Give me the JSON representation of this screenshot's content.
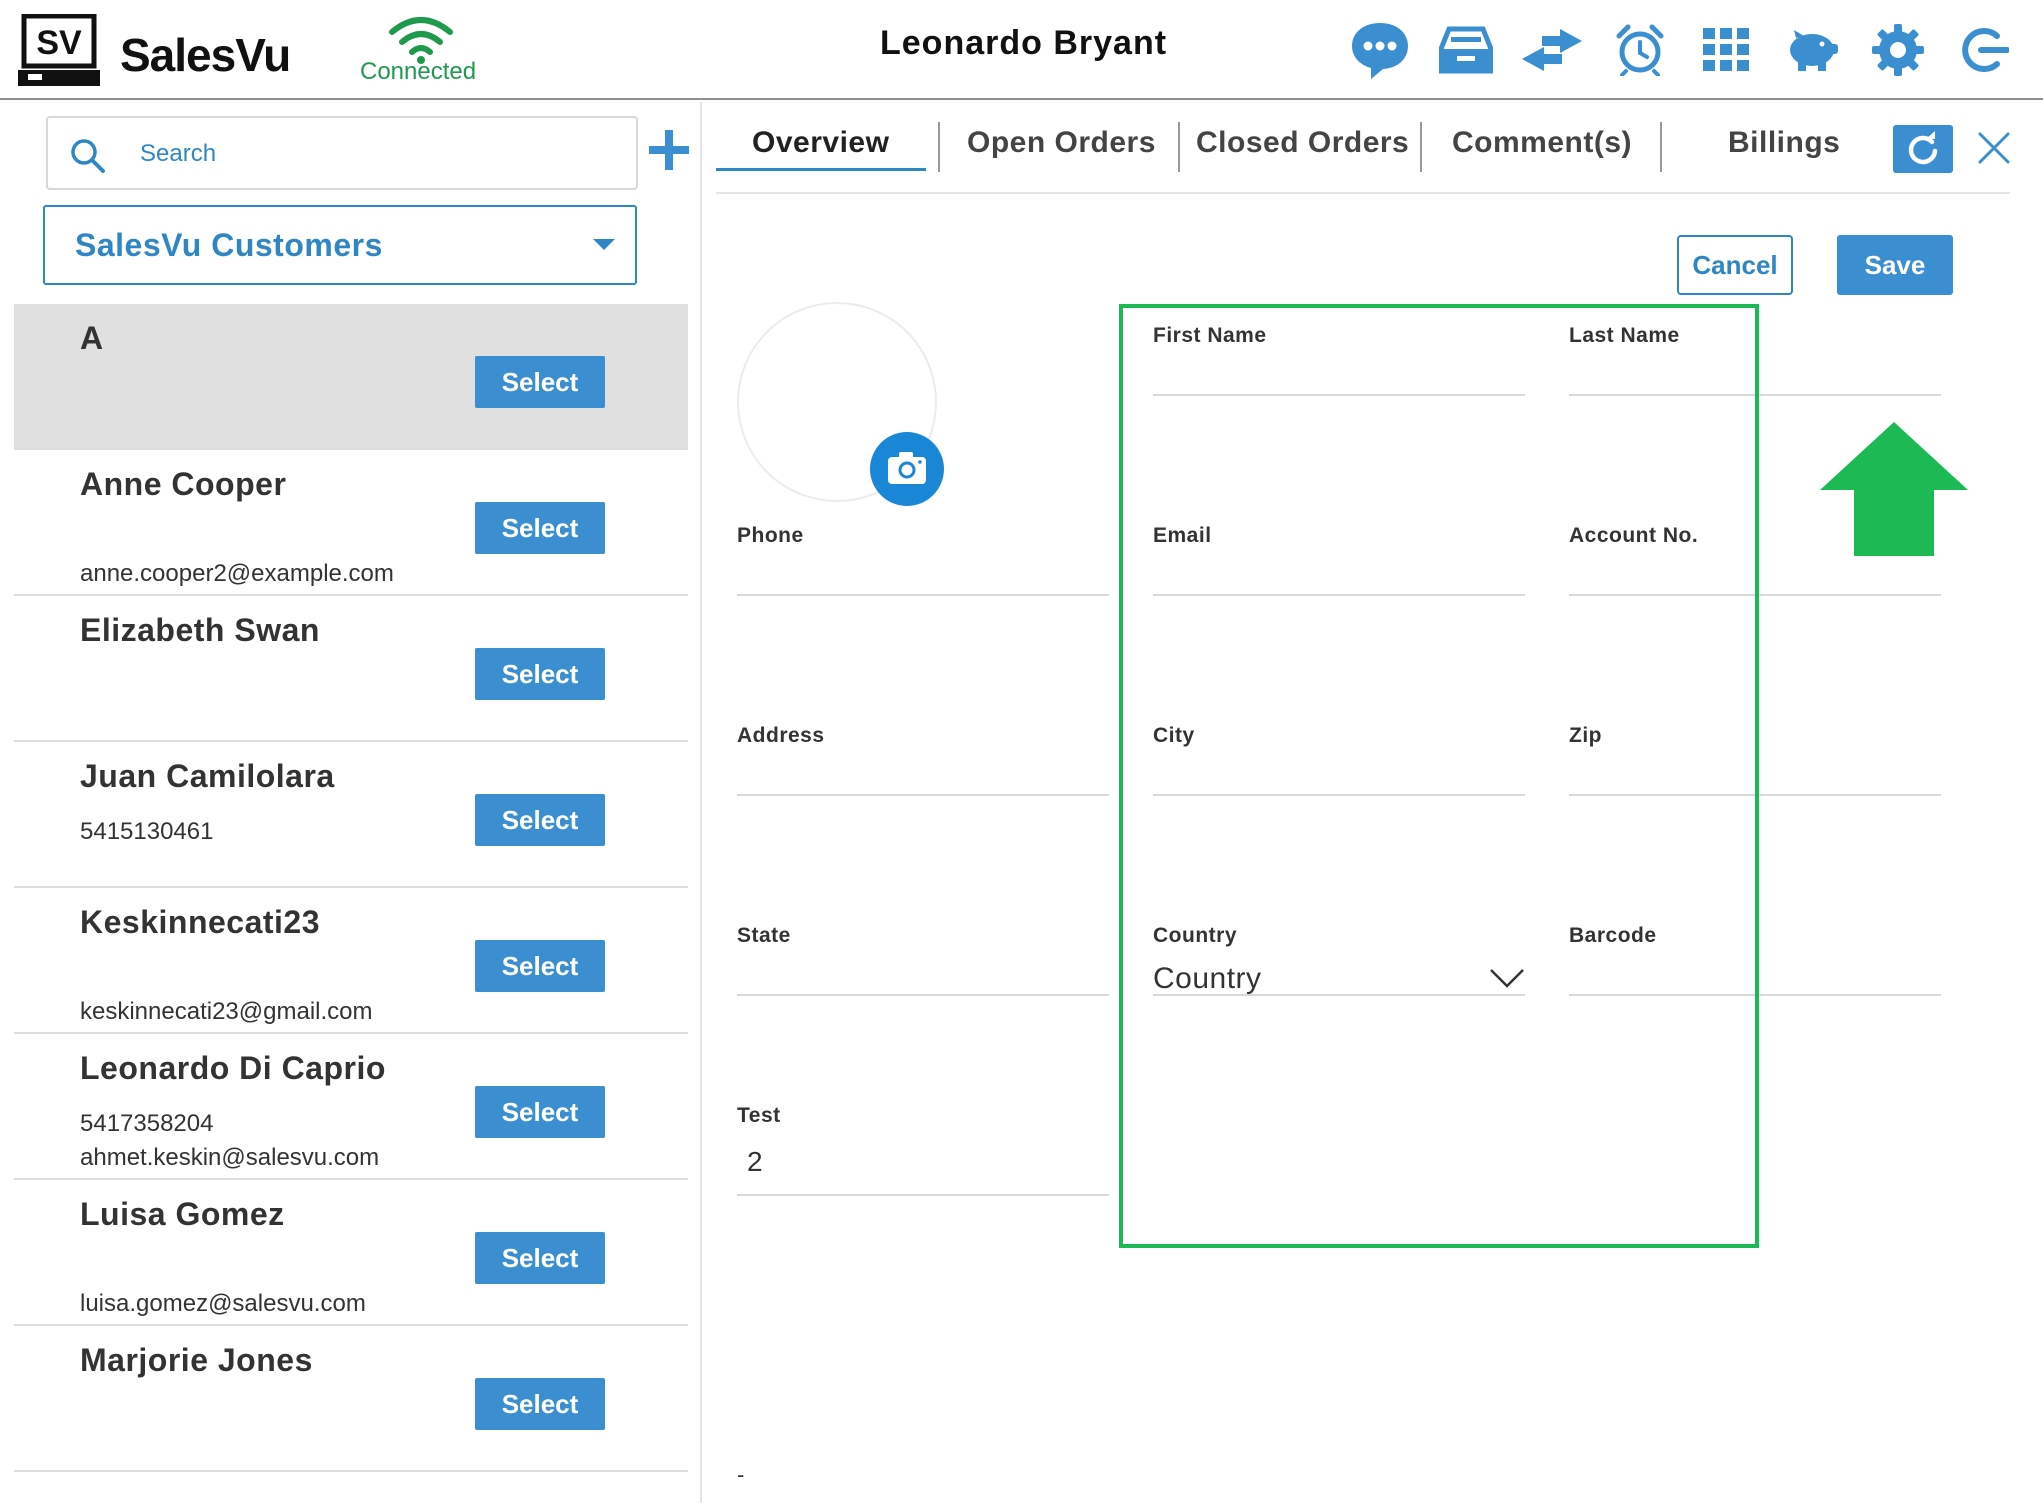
{
  "header": {
    "brand": "SalesVu",
    "logo_text": "SV",
    "connection_status": "Connected",
    "user_name": "Leonardo Bryant",
    "icons": [
      "chat-icon",
      "drawer-icon",
      "transfer-icon",
      "alarm-clock-icon",
      "grid-icon",
      "piggy-bank-icon",
      "gear-icon",
      "logout-icon"
    ]
  },
  "left_panel": {
    "search_placeholder": "Search",
    "customer_group": "SalesVu Customers",
    "select_label": "Select",
    "customers": [
      {
        "name": "A",
        "line1": "",
        "line2": "",
        "selected": true
      },
      {
        "name": "Anne Cooper",
        "line1": "",
        "line2": "anne.cooper2@example.com",
        "selected": false
      },
      {
        "name": "Elizabeth Swan",
        "line1": "",
        "line2": "",
        "selected": false
      },
      {
        "name": "Juan Camilolara",
        "line1": "5415130461",
        "line2": "",
        "selected": false
      },
      {
        "name": "Keskinnecati23",
        "line1": "",
        "line2": "keskinnecati23@gmail.com",
        "selected": false
      },
      {
        "name": "Leonardo Di Caprio",
        "line1": "5417358204",
        "line2": "ahmet.keskin@salesvu.com",
        "selected": false
      },
      {
        "name": "Luisa Gomez",
        "line1": "",
        "line2": "luisa.gomez@salesvu.com",
        "selected": false
      },
      {
        "name": "Marjorie Jones",
        "line1": "",
        "line2": "",
        "selected": false
      }
    ]
  },
  "tabs": [
    {
      "label": "Overview",
      "active": true
    },
    {
      "label": "Open Orders",
      "active": false
    },
    {
      "label": "Closed Orders",
      "active": false
    },
    {
      "label": "Comment(s)",
      "active": false
    },
    {
      "label": "Billings",
      "active": false
    }
  ],
  "form": {
    "cancel_label": "Cancel",
    "save_label": "Save",
    "phone_label": "Phone",
    "first_name_label": "First Name",
    "last_name_label": "Last Name",
    "email_label": "Email",
    "account_no_label": "Account No.",
    "address_label": "Address",
    "city_label": "City",
    "zip_label": "Zip",
    "state_label": "State",
    "country_label": "Country",
    "country_value": "Country",
    "barcode_label": "Barcode",
    "test_label": "Test",
    "test_value": "2",
    "trailing_mark": "-"
  },
  "colors": {
    "accent": "#3b8fd0",
    "connected": "#1f9a4d",
    "highlight": "#1db954",
    "selected_row": "#e0e0e0"
  }
}
